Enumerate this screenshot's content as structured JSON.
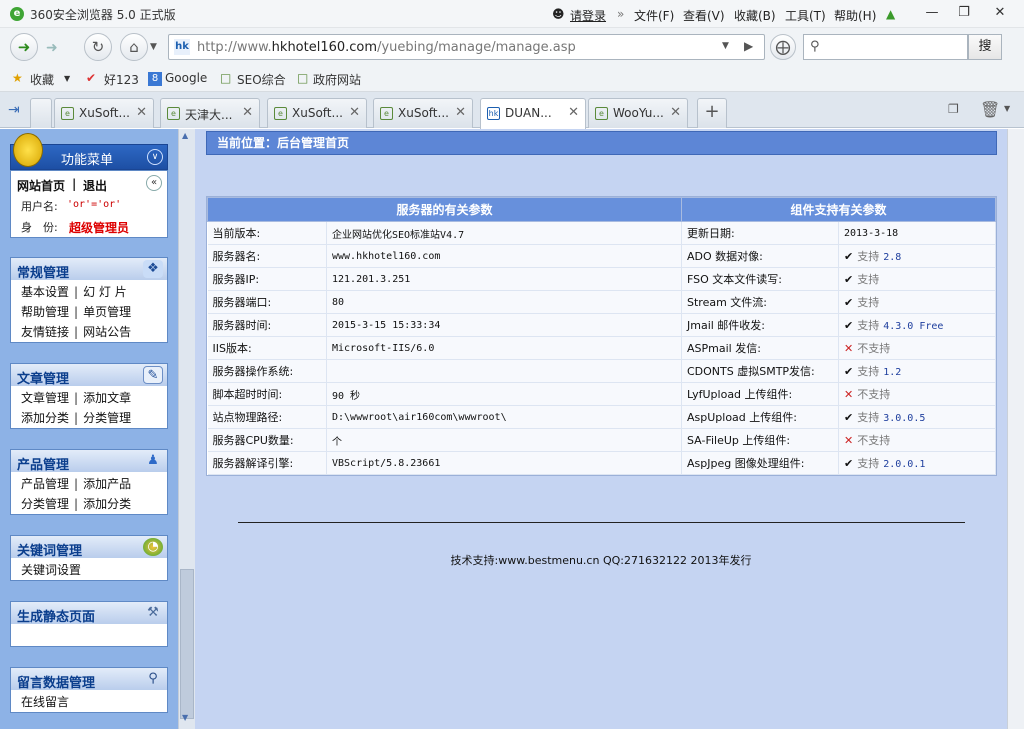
{
  "browser": {
    "title": "360安全浏览器 5.0 正式版",
    "login": "请登录",
    "menu": [
      "文件(F)",
      "查看(V)",
      "收藏(B)",
      "工具(T)",
      "帮助(H)"
    ],
    "url_prefix": "http://www.",
    "url_domain": "hkhotel160.com",
    "url_path": "/yuebing/manage/manage.asp",
    "search_button": "搜",
    "favorites": [
      "收藏",
      "好123",
      "Google",
      "SEO综合",
      "政府网站"
    ],
    "tabs": [
      "XuSoft...",
      "天津大...",
      "XuSoft...",
      "XuSoft...",
      "DUAN...",
      "WooYu..."
    ]
  },
  "sidebar": {
    "title": "功能菜单",
    "home": "网站首页",
    "logout": "退出",
    "user_label": "用户名:",
    "user_value": "'or'='or'",
    "role_label": "身　份:",
    "role_value": "超级管理员",
    "sections": [
      {
        "title": "常规管理",
        "items": [
          [
            "基本设置",
            "幻 灯 片"
          ],
          [
            "帮助管理",
            "单页管理"
          ],
          [
            "友情链接",
            "网站公告"
          ]
        ]
      },
      {
        "title": "文章管理",
        "items": [
          [
            "文章管理",
            "添加文章"
          ],
          [
            "添加分类",
            "分类管理"
          ]
        ]
      },
      {
        "title": "产品管理",
        "items": [
          [
            "产品管理",
            "添加产品"
          ],
          [
            "分类管理",
            "添加分类"
          ]
        ]
      },
      {
        "title": "关键词管理",
        "items": [
          [
            "关键词设置"
          ]
        ]
      },
      {
        "title": "生成静态页面",
        "items": [
          [
            ""
          ]
        ]
      },
      {
        "title": "留言数据管理",
        "items": [
          [
            "在线留言"
          ]
        ]
      }
    ]
  },
  "main": {
    "location": "当前位置：后台管理首页",
    "server_header": "服务器的有关参数",
    "component_header": "组件支持有关参数",
    "rows": [
      {
        "k1": "当前版本:",
        "v1": "企业网站优化SEO标准站V4.7",
        "k2": "更新日期:",
        "v2": "2013-3-18",
        "ok": null,
        "ver": ""
      },
      {
        "k1": "服务器名:",
        "v1": "www.hkhotel160.com",
        "k2": "ADO 数据对像:",
        "v2": "支持",
        "ok": true,
        "ver": "2.8"
      },
      {
        "k1": "服务器IP:",
        "v1": "121.201.3.251",
        "k2": "FSO 文本文件读写:",
        "v2": "支持",
        "ok": true,
        "ver": ""
      },
      {
        "k1": "服务器端口:",
        "v1": "80",
        "k2": "Stream 文件流:",
        "v2": "支持",
        "ok": true,
        "ver": ""
      },
      {
        "k1": "服务器时间:",
        "v1": "2015-3-15 15:33:34",
        "k2": "Jmail 邮件收发:",
        "v2": "支持",
        "ok": true,
        "ver": "4.3.0 Free"
      },
      {
        "k1": "IIS版本:",
        "v1": "Microsoft-IIS/6.0",
        "k2": "ASPmail 发信:",
        "v2": "不支持",
        "ok": false,
        "ver": ""
      },
      {
        "k1": "服务器操作系统:",
        "v1": "",
        "k2": "CDONTS 虚拟SMTP发信:",
        "v2": "支持",
        "ok": true,
        "ver": "1.2"
      },
      {
        "k1": "脚本超时时间:",
        "v1": "90 秒",
        "k2": "LyfUpload 上传组件:",
        "v2": "不支持",
        "ok": false,
        "ver": ""
      },
      {
        "k1": "站点物理路径:",
        "v1": "D:\\wwwroot\\air160com\\wwwroot\\",
        "k2": "AspUpload 上传组件:",
        "v2": "支持",
        "ok": true,
        "ver": "3.0.0.5"
      },
      {
        "k1": "服务器CPU数量:",
        "v1": "个",
        "k2": "SA-FileUp 上传组件:",
        "v2": "不支持",
        "ok": false,
        "ver": ""
      },
      {
        "k1": "服务器解译引擎:",
        "v1": "VBScript/5.8.23661",
        "k2": "AspJpeg 图像处理组件:",
        "v2": "支持",
        "ok": true,
        "ver": "2.0.0.1"
      }
    ],
    "footer": "技术支持:www.bestmenu.cn QQ:271632122 2013年发行"
  }
}
